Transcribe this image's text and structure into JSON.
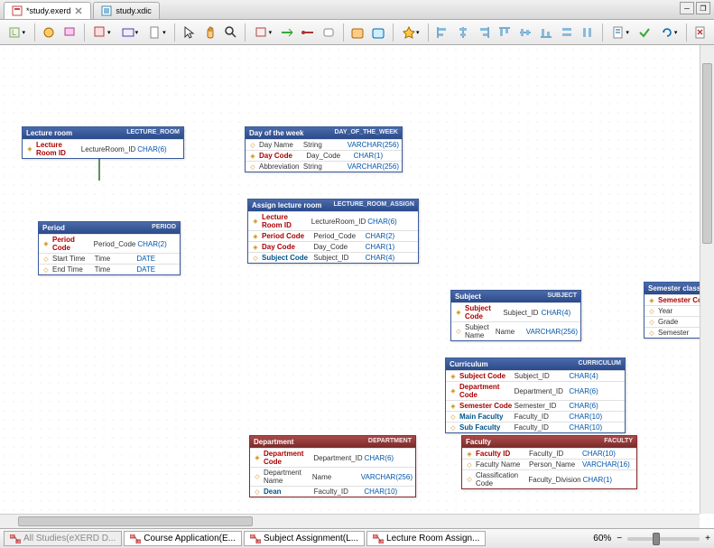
{
  "tabs": [
    {
      "label": "*study.exerd",
      "active": true
    },
    {
      "label": "study.xdic",
      "active": false
    }
  ],
  "bottom_tabs": [
    {
      "label": "All Studies(eXERD D...",
      "active": false
    },
    {
      "label": "Course Application(E...",
      "active": true
    },
    {
      "label": "Subject Assignment(L...",
      "active": true
    },
    {
      "label": "Lecture Room Assign...",
      "active": true
    }
  ],
  "zoom": {
    "value": "60%"
  },
  "entities": {
    "lecture_room": {
      "title": "Lecture room",
      "phys": "LECTURE_ROOM",
      "rows": [
        {
          "k": "◈",
          "l": "Lecture Room ID",
          "p": "LectureRoom_ID",
          "t": "CHAR(6)",
          "cls": "lname"
        }
      ]
    },
    "period": {
      "title": "Period",
      "phys": "PERIOD",
      "rows": [
        {
          "k": "◈",
          "l": "Period Code",
          "p": "Period_Code",
          "t": "CHAR(2)",
          "cls": "lname"
        },
        {
          "k": "◇",
          "l": "Start Time",
          "p": "Time",
          "t": "DATE",
          "cls": "normal"
        },
        {
          "k": "◇",
          "l": "End Time",
          "p": "Time",
          "t": "DATE",
          "cls": "normal"
        }
      ]
    },
    "day": {
      "title": "Day of the week",
      "phys": "DAY_OF_THE_WEEK",
      "rows": [
        {
          "k": "◇",
          "l": "Day Name",
          "p": "String",
          "t": "VARCHAR(256)",
          "cls": "normal"
        },
        {
          "k": "◈",
          "l": "Day Code",
          "p": "Day_Code",
          "t": "CHAR(1)",
          "cls": "lname"
        },
        {
          "k": "◇",
          "l": "Abbreviation",
          "p": "String",
          "t": "VARCHAR(256)",
          "cls": "normal"
        }
      ]
    },
    "assign": {
      "title": "Assign lecture room",
      "phys": "LECTURE_ROOM_ASSIGN",
      "rows": [
        {
          "k": "◈",
          "l": "Lecture Room ID",
          "p": "LectureRoom_ID",
          "t": "CHAR(6)",
          "cls": "lname"
        },
        {
          "k": "◈",
          "l": "Period Code",
          "p": "Period_Code",
          "t": "CHAR(2)",
          "cls": "lname"
        },
        {
          "k": "◈",
          "l": "Day Code",
          "p": "Day_Code",
          "t": "CHAR(1)",
          "cls": "lname"
        },
        {
          "k": "◇",
          "l": "Subject Code",
          "p": "Subject_ID",
          "t": "CHAR(4)",
          "cls": "fk"
        }
      ]
    },
    "subject": {
      "title": "Subject",
      "phys": "SUBJECT",
      "rows": [
        {
          "k": "◈",
          "l": "Subject Code",
          "p": "Subject_ID",
          "t": "CHAR(4)",
          "cls": "lname"
        },
        {
          "k": "◇",
          "l": "Subject Name",
          "p": "Name",
          "t": "VARCHAR(256)",
          "cls": "normal"
        }
      ]
    },
    "semclass": {
      "title": "Semester class",
      "phys": "",
      "rows": [
        {
          "k": "◈",
          "l": "Semester Co",
          "p": "",
          "t": "",
          "cls": "lname"
        },
        {
          "k": "◇",
          "l": "Year",
          "p": "",
          "t": "",
          "cls": "normal"
        },
        {
          "k": "◇",
          "l": "Grade",
          "p": "",
          "t": "",
          "cls": "normal"
        },
        {
          "k": "◇",
          "l": "Semester",
          "p": "",
          "t": "",
          "cls": "normal"
        }
      ]
    },
    "curriculum": {
      "title": "Curriculum",
      "phys": "CURRICULUM",
      "rows": [
        {
          "k": "◈",
          "l": "Subject Code",
          "p": "Subject_ID",
          "t": "CHAR(4)",
          "cls": "lname"
        },
        {
          "k": "◈",
          "l": "Department Code",
          "p": "Department_ID",
          "t": "CHAR(6)",
          "cls": "lname"
        },
        {
          "k": "◈",
          "l": "Semester Code",
          "p": "Semester_ID",
          "t": "CHAR(6)",
          "cls": "lname"
        },
        {
          "k": "◇",
          "l": "Main Faculty",
          "p": "Faculty_ID",
          "t": "CHAR(10)",
          "cls": "fk"
        },
        {
          "k": "◇",
          "l": "Sub Faculty",
          "p": "Faculty_ID",
          "t": "CHAR(10)",
          "cls": "fk"
        }
      ]
    },
    "department": {
      "title": "Department",
      "phys": "DEPARTMENT",
      "rows": [
        {
          "k": "◈",
          "l": "Department Code",
          "p": "Department_ID",
          "t": "CHAR(6)",
          "cls": "lname"
        },
        {
          "k": "◇",
          "l": "Department Name",
          "p": "Name",
          "t": "VARCHAR(256)",
          "cls": "normal"
        },
        {
          "k": "◇",
          "l": "Dean",
          "p": "Faculty_ID",
          "t": "CHAR(10)",
          "cls": "fk"
        }
      ]
    },
    "faculty": {
      "title": "Faculty",
      "phys": "FACULTY",
      "rows": [
        {
          "k": "◈",
          "l": "Faculty ID",
          "p": "Faculty_ID",
          "t": "CHAR(10)",
          "cls": "lname"
        },
        {
          "k": "◇",
          "l": "Faculty Name",
          "p": "Person_Name",
          "t": "VARCHAR(16)",
          "cls": "normal"
        },
        {
          "k": "◇",
          "l": "Classification Code",
          "p": "Faculty_Division",
          "t": "CHAR(1)",
          "cls": "normal"
        }
      ]
    }
  }
}
